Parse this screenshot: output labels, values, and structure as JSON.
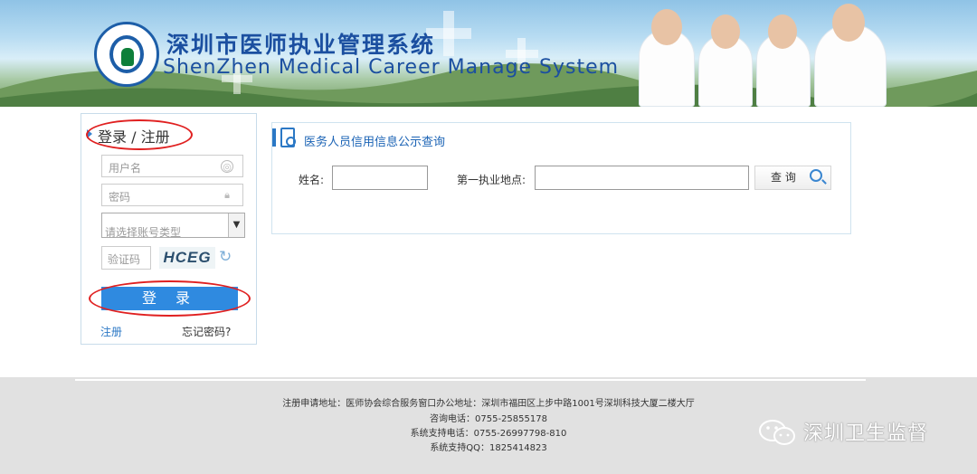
{
  "header": {
    "title_cn": "深圳市医师执业管理系统",
    "title_en": "ShenZhen Medical Career Manage System"
  },
  "login": {
    "title": "登录 / 注册",
    "username_placeholder": "用户名",
    "password_placeholder": "密码",
    "account_type_selected": "请选择账号类型",
    "captcha_placeholder": "验证码",
    "captcha_text": "HCEG",
    "login_button": "登 录",
    "register_link": "注册",
    "forgot_link": "忘记密码?"
  },
  "query": {
    "title": "医务人员信用信息公示查询",
    "name_label": "姓名:",
    "location_label": "第一执业地点:",
    "search_button": "查 询"
  },
  "footer": {
    "address": "注册申请地址：医师协会综合服务窗口办公地址：深圳市福田区上步中路1001号深圳科技大厦二楼大厅",
    "consult_phone": "咨询电话：0755-25855178",
    "support_phone": "系统支持电话：0755-26997798-810",
    "support_qq": "系统支持QQ：1825414823"
  },
  "watermark": {
    "text": "深圳卫生监督"
  },
  "colors": {
    "brand_blue": "#1b4fa0",
    "button_blue": "#2f8ae0",
    "annotation_red": "#e02020"
  }
}
